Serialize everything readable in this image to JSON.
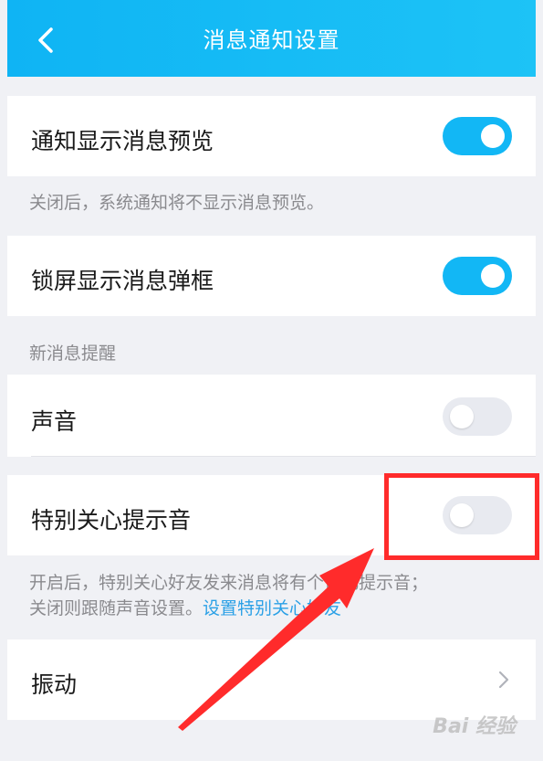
{
  "header": {
    "title": "消息通知设置",
    "back_icon": "chevron-left-icon"
  },
  "rows": {
    "preview": {
      "label": "通知显示消息预览",
      "enabled": true
    },
    "lockscreen": {
      "label": "锁屏显示消息弹框",
      "enabled": true
    },
    "sound": {
      "label": "声音",
      "enabled": false
    },
    "special_care": {
      "label": "特别关心提示音",
      "enabled": false
    },
    "vibration": {
      "label": "振动",
      "icon": "chevron-right-icon"
    }
  },
  "notes": {
    "preview_note": "关闭后，系统通知将不显示消息预览。",
    "special_note_line1": "开启后，特别关心好友发来消息将有个性化提示音；",
    "special_note_line2": "关闭则跟随声音设置。",
    "special_link": "设置特别关心好友"
  },
  "sections": {
    "new_message": "新消息提醒"
  },
  "watermark": {
    "text": "Bai 经验"
  },
  "colors": {
    "accent": "#12b7f5",
    "header": "#0fb4f4",
    "annotation": "#ff2b2b"
  }
}
